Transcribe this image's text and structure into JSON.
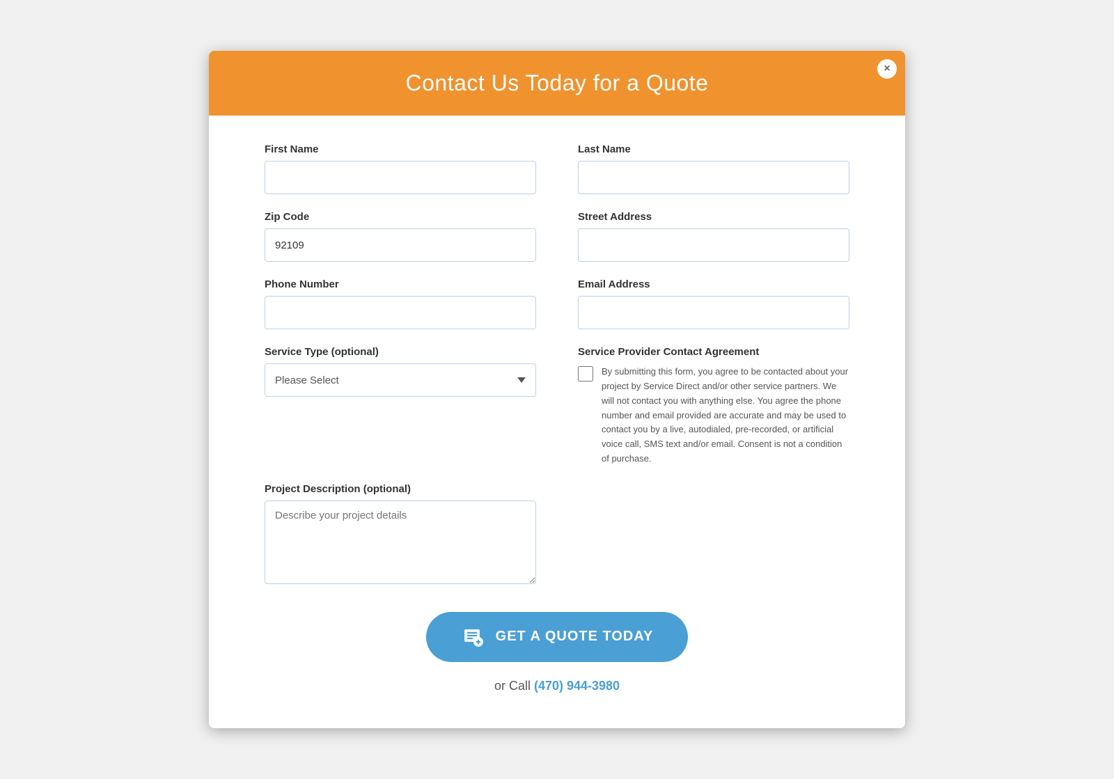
{
  "modal": {
    "title": "Contact Us Today for a Quote",
    "close_label": "×"
  },
  "form": {
    "first_name_label": "First Name",
    "first_name_placeholder": "",
    "last_name_label": "Last Name",
    "last_name_placeholder": "",
    "zip_code_label": "Zip Code",
    "zip_code_value": "92109",
    "street_address_label": "Street Address",
    "street_address_placeholder": "",
    "phone_number_label": "Phone Number",
    "phone_number_placeholder": "",
    "email_address_label": "Email Address",
    "email_address_placeholder": "",
    "service_type_label": "Service Type (optional)",
    "service_type_placeholder": "Please Select",
    "project_description_label": "Project Description (optional)",
    "project_description_placeholder": "Describe your project details",
    "agreement_label": "Service Provider Contact Agreement",
    "agreement_text": "By submitting this form, you agree to be contacted about your project by Service Direct and/or other service partners. We will not contact you with anything else. You agree the phone number and email provided are accurate and may be used to contact you by a live, autodialed, pre-recorded, or artificial voice call, SMS text and/or email. Consent is not a condition of purchase."
  },
  "footer": {
    "quote_button_label": "GET A QUOTE TODAY",
    "call_prefix": "or Call ",
    "call_number": "(470) 944-3980",
    "call_href": "tel:4709443980"
  },
  "colors": {
    "header_bg": "#f0922e",
    "button_bg": "#4a9fd4",
    "input_border": "#bcd0e5"
  }
}
